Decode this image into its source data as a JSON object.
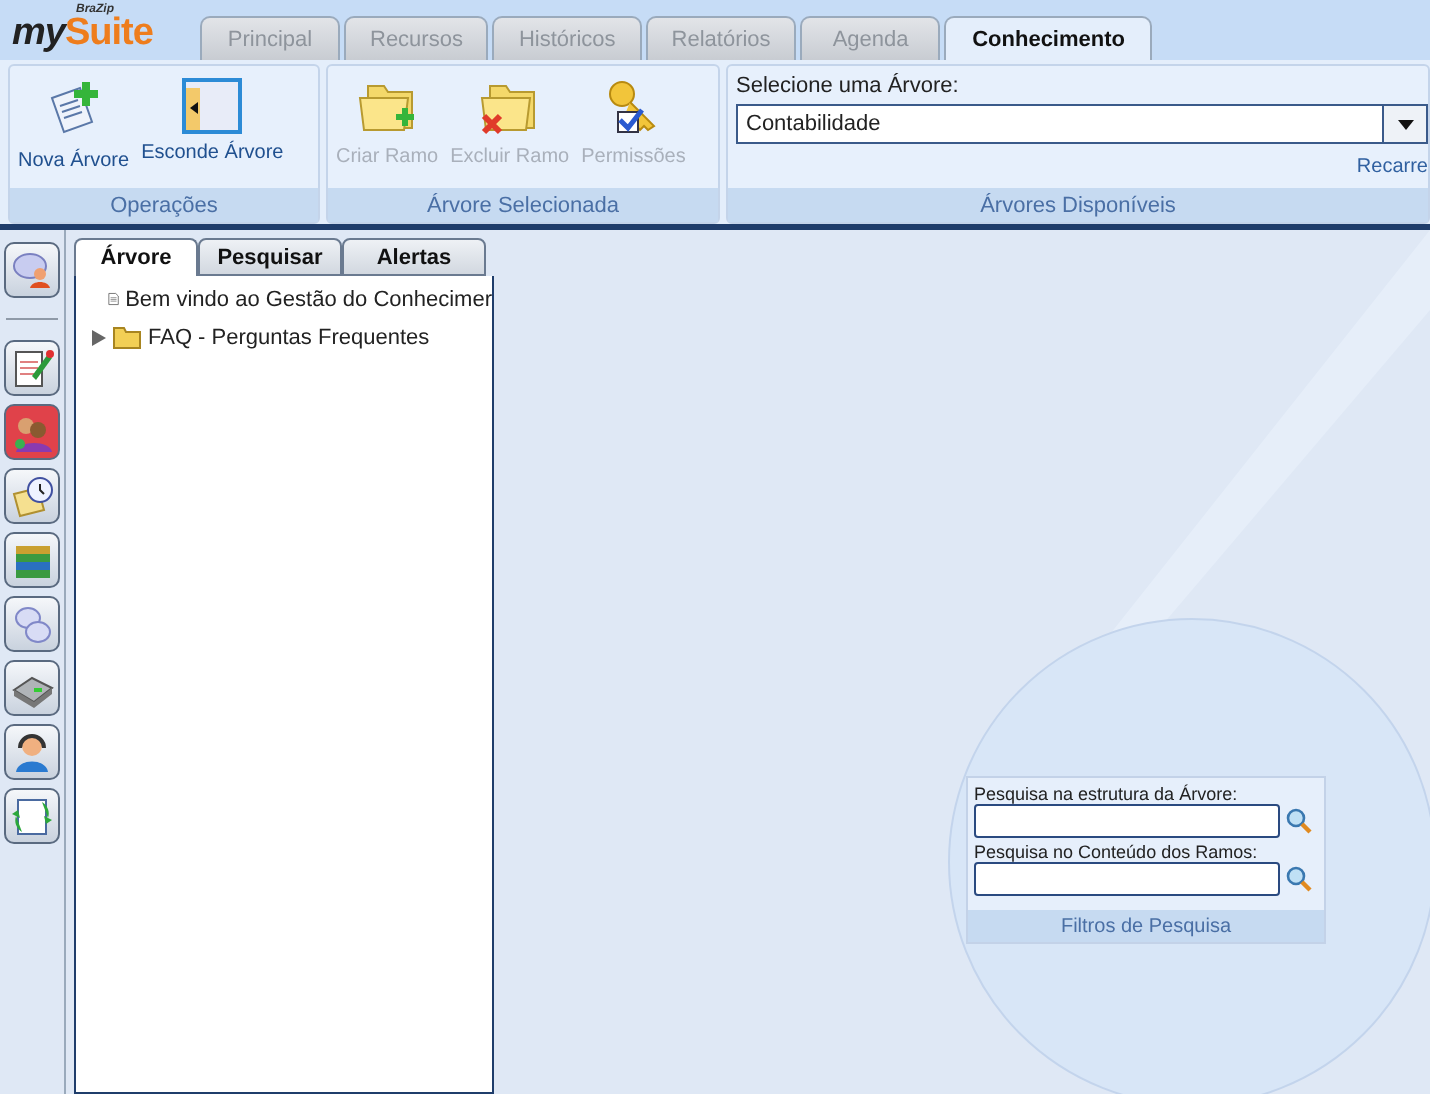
{
  "logo": {
    "small": "BraZip",
    "name_left": "my",
    "name_right": "Suite"
  },
  "tabs": [
    {
      "label": "Principal",
      "selected": false
    },
    {
      "label": "Recursos",
      "selected": false
    },
    {
      "label": "Históricos",
      "selected": false
    },
    {
      "label": "Relatórios",
      "selected": false
    },
    {
      "label": "Agenda",
      "selected": false
    },
    {
      "label": "Conhecimento",
      "selected": true
    }
  ],
  "ribbon": {
    "groups": [
      {
        "title": "Operações",
        "kind": "buttons",
        "buttons": [
          {
            "label": "Nova Árvore",
            "disabled": false
          },
          {
            "label": "Esconde Árvore",
            "disabled": false
          }
        ]
      },
      {
        "title": "Árvore Selecionada",
        "kind": "buttons",
        "buttons": [
          {
            "label": "Criar Ramo",
            "disabled": true
          },
          {
            "label": "Excluir Ramo",
            "disabled": true
          },
          {
            "label": "Permissões",
            "disabled": true
          }
        ]
      },
      {
        "title": "Árvores Disponíveis",
        "kind": "select",
        "label": "Selecione uma Árvore:",
        "value": "Contabilidade",
        "link": "Recarre"
      }
    ]
  },
  "sidebar": {
    "items": [
      {
        "selected": false
      },
      {
        "selected": false
      },
      {
        "selected": true
      },
      {
        "selected": false
      },
      {
        "selected": false
      },
      {
        "selected": false
      },
      {
        "selected": false
      },
      {
        "selected": false
      },
      {
        "selected": false
      }
    ]
  },
  "tree_panel": {
    "tabs": [
      {
        "label": "Árvore",
        "selected": true
      },
      {
        "label": "Pesquisar",
        "selected": false
      },
      {
        "label": "Alertas",
        "selected": false
      }
    ],
    "items": [
      {
        "label": "Bem vindo ao Gestão do Conhecimer",
        "kind": "document"
      },
      {
        "label": "FAQ - Perguntas Frequentes",
        "kind": "folder"
      }
    ]
  },
  "filters": {
    "title": "Filtros de Pesquisa",
    "fields": [
      {
        "label": "Pesquisa na estrutura da Árvore:"
      },
      {
        "label": "Pesquisa no Conteúdo dos Ramos:"
      }
    ]
  }
}
